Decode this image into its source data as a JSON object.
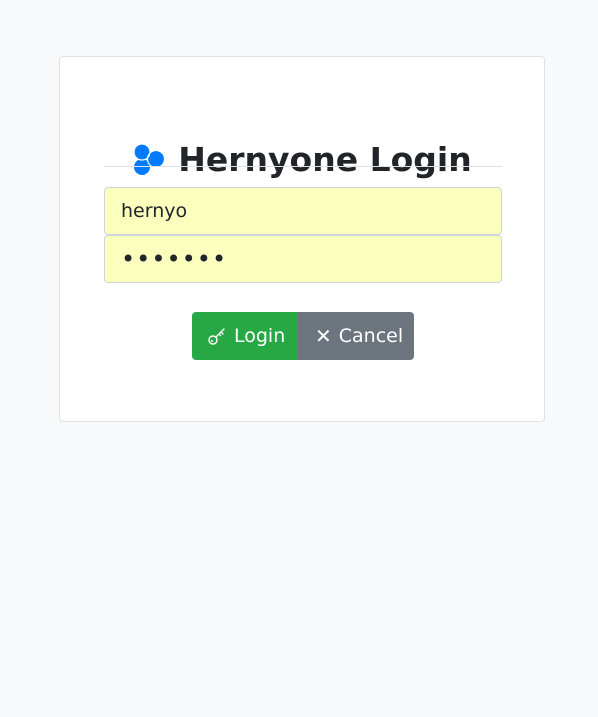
{
  "header": {
    "icon": "bubbles-logo-icon",
    "title": "Hernyone Login",
    "accent_color": "#007bff"
  },
  "form": {
    "username_value": "hernyo",
    "password_value": "•••••••",
    "field_autofill_color": "#faffbd"
  },
  "buttons": {
    "login_label": "Login",
    "login_icon": "key-icon",
    "login_color": "#28a745",
    "cancel_label": "Cancel",
    "cancel_icon": "close-icon",
    "cancel_color": "#6c757d"
  }
}
